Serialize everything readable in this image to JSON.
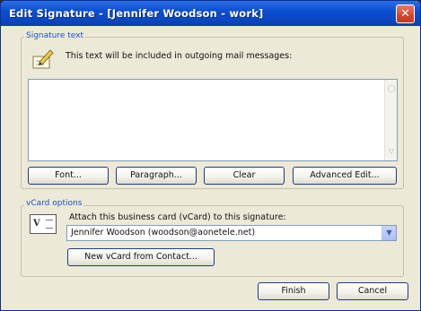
{
  "window": {
    "title": "Edit Signature - [Jennifer Woodson - work]",
    "close_glyph": "✕"
  },
  "signature_group": {
    "legend": "Signature text",
    "hint": "This text will be included in outgoing mail messages:",
    "text_value": "",
    "buttons": {
      "font": "Font...",
      "paragraph": "Paragraph...",
      "clear": "Clear",
      "advanced_edit": "Advanced Edit..."
    }
  },
  "vcard_group": {
    "legend": "vCard options",
    "attach_label": "Attach this business card (vCard) to this signature:",
    "selected_card": "Jennifer Woodson (woodson@aonetele.net)",
    "new_from_contact": "New vCard from Contact...",
    "icon_text": "V"
  },
  "footer": {
    "finish": "Finish",
    "cancel": "Cancel"
  },
  "colors": {
    "title_bar": "#0a4fd1",
    "dialog_bg": "#ece9d8",
    "group_legend": "#1a4fc4"
  }
}
